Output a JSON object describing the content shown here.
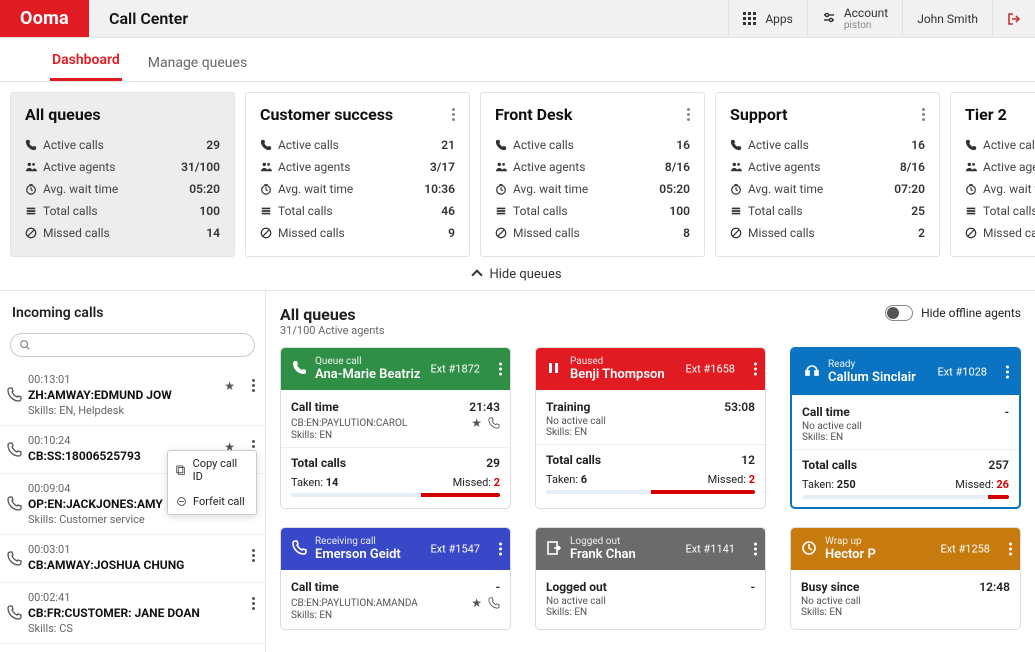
{
  "header": {
    "logo": "Ooma",
    "app_title": "Call Center",
    "apps_label": "Apps",
    "account_label": "Account",
    "account_sub": "piston",
    "user": "John Smith"
  },
  "tabs": [
    {
      "label": "Dashboard",
      "active": true
    },
    {
      "label": "Manage queues",
      "active": false
    }
  ],
  "queues": [
    {
      "title": "All queues",
      "active_calls": "29",
      "active_agents": "31/100",
      "avg_wait": "05:20",
      "total_calls": "100",
      "missed": "14",
      "is_all": true
    },
    {
      "title": "Customer success",
      "active_calls": "21",
      "active_agents": "3/17",
      "avg_wait": "10:36",
      "total_calls": "46",
      "missed": "9"
    },
    {
      "title": "Front Desk",
      "active_calls": "16",
      "active_agents": "8/16",
      "avg_wait": "05:20",
      "total_calls": "100",
      "missed": "8"
    },
    {
      "title": "Support",
      "active_calls": "16",
      "active_agents": "8/16",
      "avg_wait": "07:20",
      "total_calls": "25",
      "missed": "2"
    },
    {
      "title": "Tier 2",
      "active_calls": "",
      "active_agents": "",
      "avg_wait": "",
      "total_calls": "",
      "missed": ""
    }
  ],
  "queue_labels": {
    "active_calls": "Active calls",
    "active_agents": "Active agents",
    "avg_wait": "Avg. wait time",
    "total_calls": "Total calls",
    "missed": "Missed calls"
  },
  "hide_queues": "Hide queues",
  "incoming": {
    "title": "Incoming calls",
    "items": [
      {
        "time": "00:13:01",
        "name": "ZH:AMWAY:EDMUND JOW",
        "skills": "Skills: EN, Helpdesk",
        "starred": true
      },
      {
        "time": "00:10:24",
        "name": "CB:SS:18006525793",
        "skills": "",
        "starred": true,
        "popup": true
      },
      {
        "time": "00:09:04",
        "name": "OP:EN:JACKJONES:AMY",
        "skills": "Skills: Customer service"
      },
      {
        "time": "00:03:01",
        "name": "CB:AMWAY:JOSHUA CHUNG",
        "skills": ""
      },
      {
        "time": "00:02:41",
        "name": "CB:FR:CUSTOMER: JANE DOAN",
        "skills": "Skills: CS"
      }
    ],
    "popup_copy": "Copy call ID",
    "popup_forfeit": "Forfeit call"
  },
  "right": {
    "title": "All queues",
    "subtitle": "31/100 Active agents",
    "toggle_label": "Hide offline agents"
  },
  "agents": [
    {
      "color": "green",
      "state": "Queue call",
      "name": "Ana-Marie Beatriz",
      "ext": "Ext #1872",
      "row1_k": "Call time",
      "row1_v": "21:43",
      "sub1": "CB:EN:PAYLUTION:CAROL",
      "sub2": "Skills: EN",
      "total_label": "Total calls",
      "total": "29",
      "taken_label": "Taken:",
      "taken": "14",
      "missed_label": "Missed:",
      "missed": "2",
      "bar_pct": 38,
      "show_star": true
    },
    {
      "color": "red",
      "state": "Paused",
      "name": "Benji Thompson",
      "ext": "Ext #1658",
      "row1_k": "Training",
      "row1_v": "53:08",
      "sub1": "No active call",
      "sub2": "Skills: EN",
      "total_label": "Total calls",
      "total": "12",
      "taken_label": "Taken:",
      "taken": "6",
      "missed_label": "Missed:",
      "missed": "2",
      "bar_pct": 50
    },
    {
      "color": "blue",
      "state": "Ready",
      "name": "Callum Sinclair",
      "ext": "Ext #1028",
      "row1_k": "Call time",
      "row1_v": "-",
      "sub1": "No active call",
      "sub2": "Skills: EN",
      "total_label": "Total calls",
      "total": "257",
      "taken_label": "Taken:",
      "taken": "250",
      "missed_label": "Missed:",
      "missed": "26",
      "bar_pct": 10,
      "blue_border": true
    },
    {
      "color": "purple",
      "state": "Receiving call",
      "name": "Emerson Geidt",
      "ext": "Ext #1547",
      "row1_k": "Call time",
      "row1_v": "-",
      "sub1": "CB:EN:PAYLUTION:AMANDA",
      "sub2": "Skills: EN",
      "show_star": true,
      "no_totals": true
    },
    {
      "color": "gray",
      "state": "Logged out",
      "name": "Frank Chan",
      "ext": "Ext #1141",
      "row1_k": "Logged out",
      "row1_v": "-",
      "sub1": "No active call",
      "sub2": "Skills: EN",
      "no_totals": true
    },
    {
      "color": "orange",
      "state": "Wrap up",
      "name": "Hector P",
      "ext": "Ext #1258",
      "row1_k": "Busy since",
      "row1_v": "12:48",
      "sub1": "No active call",
      "sub2": "Skills: EN",
      "no_totals": true
    }
  ]
}
